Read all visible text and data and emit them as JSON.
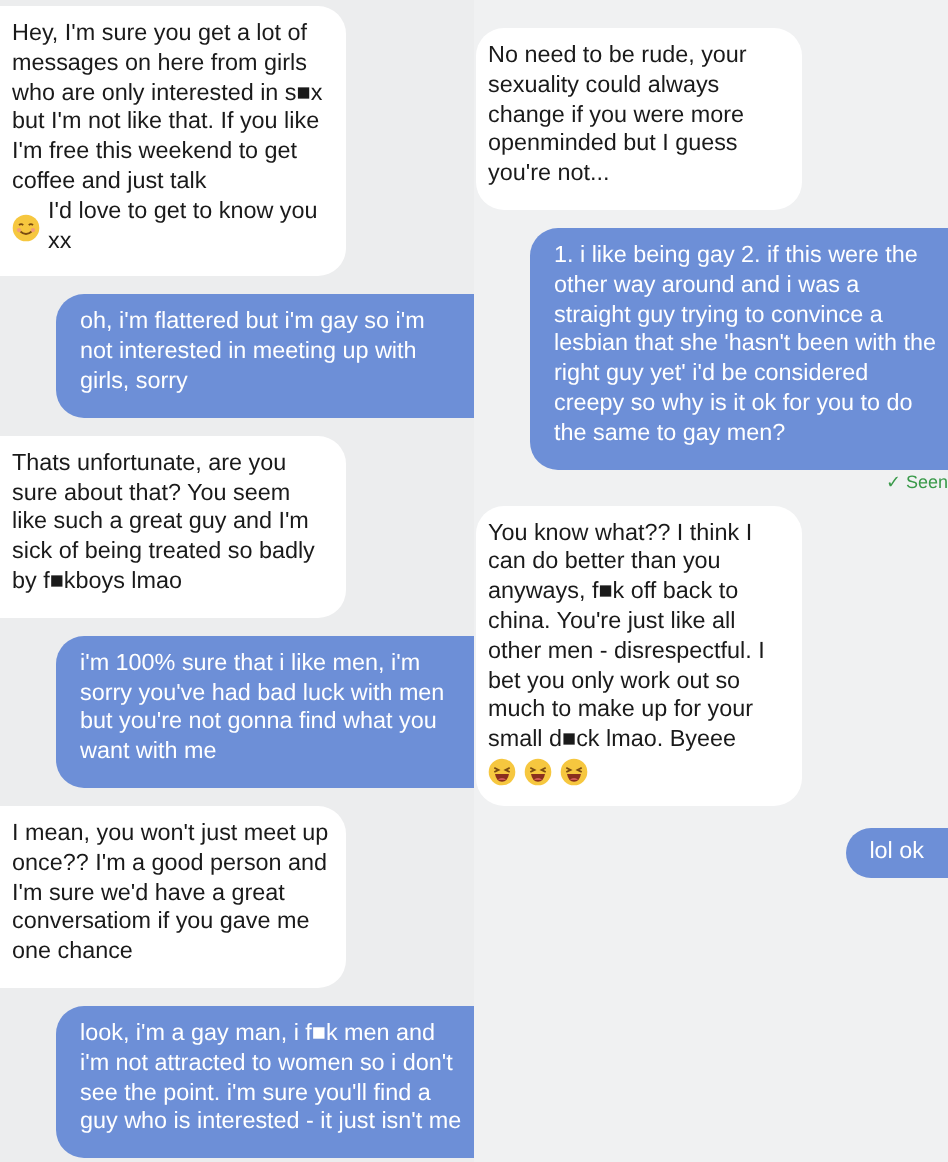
{
  "columns": [
    {
      "messages": [
        {
          "kind": "received",
          "parts": [
            {
              "kind": "text",
              "text": "Hey, I'm sure you get a lot of messages on here from girls who are only interested in s■x but I'm not like that. If you like I'm free this weekend to get coffee and just talk"
            },
            {
              "kind": "smile"
            },
            {
              "kind": "text",
              "text": "I'd love to get to know you xx"
            }
          ]
        },
        {
          "kind": "sent",
          "parts": [
            {
              "kind": "text",
              "text": "oh, i'm flattered but i'm gay so i'm not interested in meeting up with girls, sorry"
            }
          ]
        },
        {
          "kind": "received",
          "parts": [
            {
              "kind": "text",
              "text": "Thats unfortunate, are you sure about that? You seem like such a great guy and I'm sick of being treated so badly by f■kboys lmao"
            }
          ]
        },
        {
          "kind": "sent",
          "parts": [
            {
              "kind": "text",
              "text": "i'm 100% sure that i like men, i'm sorry you've had bad luck with men but you're not gonna find what you want with me"
            }
          ]
        },
        {
          "kind": "received",
          "parts": [
            {
              "kind": "text",
              "text": "I mean, you won't just meet up once?? I'm a good person and I'm sure we'd have a great conversatiom if you gave me one chance"
            }
          ]
        },
        {
          "kind": "sent",
          "parts": [
            {
              "kind": "text",
              "text": "look, i'm a gay man, i f■k men and i'm not attracted to women so i don't see the point. i'm sure you'll find a guy who is interested - it just isn't me"
            }
          ]
        }
      ]
    },
    {
      "messages": [
        {
          "kind": "received",
          "parts": [
            {
              "kind": "text",
              "text": "No need to be rude, your sexuality could always change if you were more openminded but I guess you're not..."
            }
          ]
        },
        {
          "kind": "sent",
          "parts": [
            {
              "kind": "text",
              "text": "1. i like being gay 2. if this were the other way around and i was a straight guy trying to convince a lesbian that she 'hasn't been with the right guy yet' i'd be considered creepy so why is it ok for you to do the same to gay men?"
            }
          ]
        },
        {
          "kind": "seen",
          "text": "✓ Seen"
        },
        {
          "kind": "received",
          "parts": [
            {
              "kind": "text",
              "text": "You know what?? I think I can do better than you anyways, f■k off back to china. You're just like all other men - disrespectful. I bet you only work out so much to make up for your small d■ck lmao. Byeee"
            },
            {
              "kind": "laugh"
            },
            {
              "kind": "laugh"
            },
            {
              "kind": "laugh"
            }
          ]
        },
        {
          "kind": "sent",
          "parts": [
            {
              "kind": "text",
              "text": "lol ok"
            }
          ]
        }
      ]
    }
  ]
}
